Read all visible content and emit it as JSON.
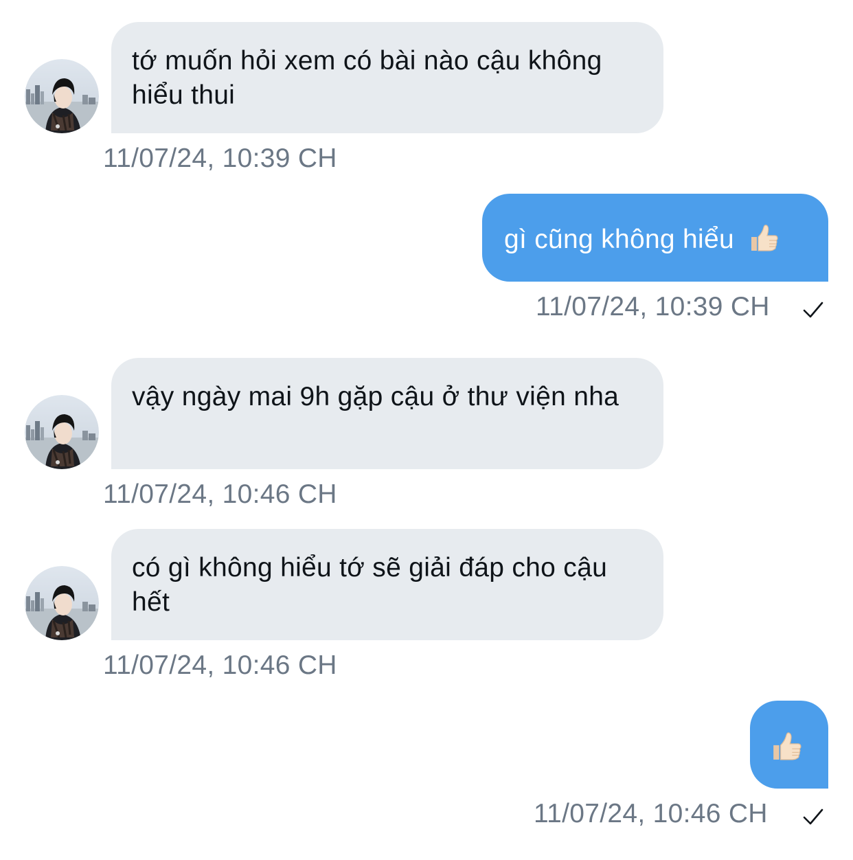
{
  "conversation": {
    "messages": [
      {
        "direction": "incoming",
        "text": "tớ muốn hỏi xem có bài nào cậu không hiểu thui",
        "timestamp": "11/07/24, 10:39 CH"
      },
      {
        "direction": "outgoing",
        "text": "gì cũng không hiểu",
        "emoji": "thumbs-up-icon",
        "timestamp": "11/07/24, 10:39 CH",
        "status": "sent"
      },
      {
        "direction": "incoming",
        "text": "vậy ngày mai 9h gặp cậu ở thư viện nha",
        "timestamp": "11/07/24, 10:46 CH"
      },
      {
        "direction": "incoming",
        "text": "có gì không hiểu tớ sẽ giải đáp cho cậu hết",
        "timestamp": "11/07/24, 10:46 CH"
      },
      {
        "direction": "outgoing",
        "text": "",
        "emoji": "thumbs-up-icon",
        "timestamp": "11/07/24, 10:46 CH",
        "status": "sent"
      }
    ]
  },
  "colors": {
    "incoming_bubble": "#e7ebef",
    "outgoing_bubble": "#4c9eeb",
    "timestamp": "#6b7785",
    "text": "#0f1419"
  }
}
